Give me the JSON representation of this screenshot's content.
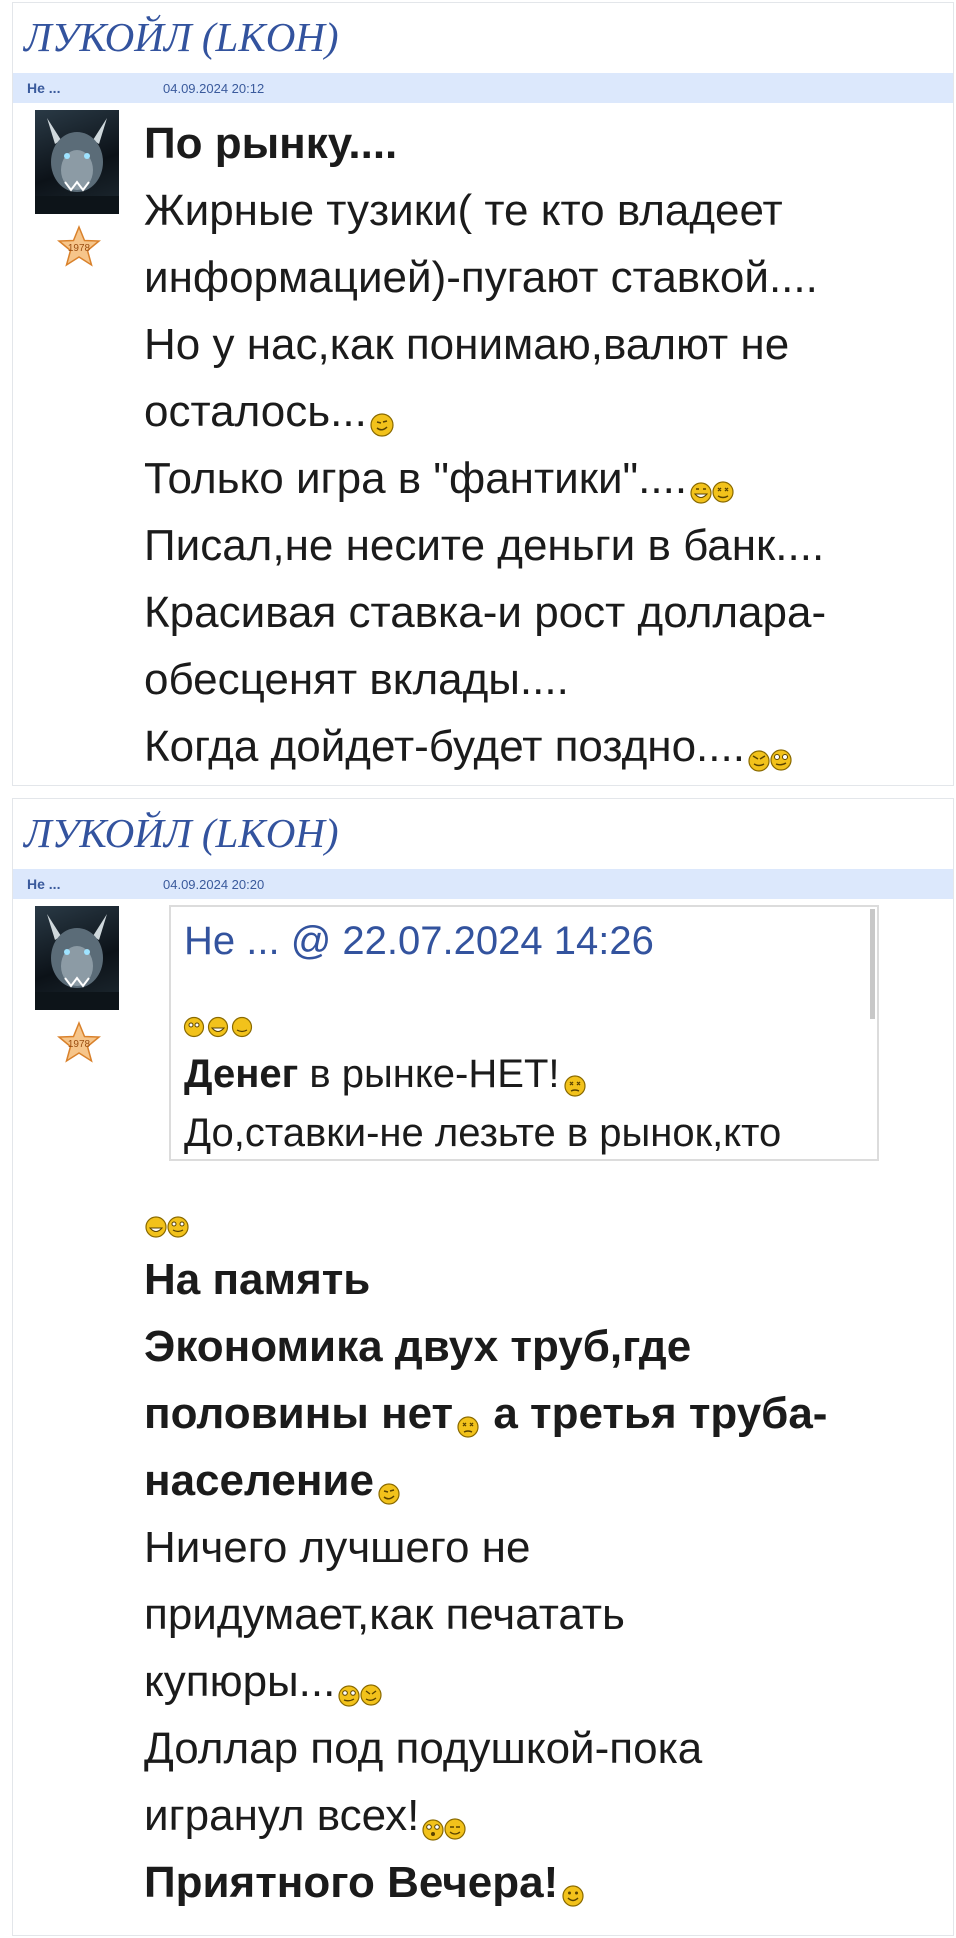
{
  "posts": [
    {
      "forum_title": "ЛУКОЙЛ (LKOH)",
      "author": "Не ...",
      "datetime": "04.09.2024 20:12",
      "rank_badge": "1978",
      "lines": [
        {
          "text": "По рынку....",
          "bold": true
        },
        {
          "text": "Жирные тузики( те кто владеет"
        },
        {
          "text": "информацией)-пугают ставкой...."
        },
        {
          "text": "Но у нас,как понимаю,валют не"
        },
        {
          "text": "осталось..."
        },
        {
          "text": "Только игра в \"фантики\"...."
        },
        {
          "text": "Писал,не несите деньги в банк...."
        },
        {
          "text": "Красивая ставка-и рост доллара-"
        },
        {
          "text": "обесценят вклады...."
        },
        {
          "text": "Когда дойдет-будет поздно...."
        }
      ]
    },
    {
      "forum_title": "ЛУКОЙЛ (LKOH)",
      "author": "Не ...",
      "datetime": "04.09.2024 20:20",
      "rank_badge": "1978",
      "quote": {
        "header": "Не ... @ 22.07.2024 14:26",
        "bold_word": "Денег",
        "line1_rest": " в рынке-НЕТ!",
        "line2": "До,ставки-не лезьте в рынок,кто"
      },
      "lines": [
        {
          "text": "На память",
          "bold": true
        },
        {
          "text": "Экономика двух труб,где",
          "bold": true
        },
        {
          "text": "половины нет",
          "bold": true
        },
        {
          "text": " а третья труба-",
          "bold": true
        },
        {
          "text": "население",
          "bold": true
        },
        {
          "text": "Ничего лучшего не"
        },
        {
          "text": "придумает,как печатать"
        },
        {
          "text": "купюры..."
        },
        {
          "text": "Доллар под подушкой-пока"
        },
        {
          "text": "игранул всех!"
        },
        {
          "text": "Приятного Вечера!",
          "bold": true
        }
      ]
    }
  ],
  "colors": {
    "title": "#33539e",
    "meta_bar": "#dce8fc",
    "smiley": "#f2c21b"
  }
}
